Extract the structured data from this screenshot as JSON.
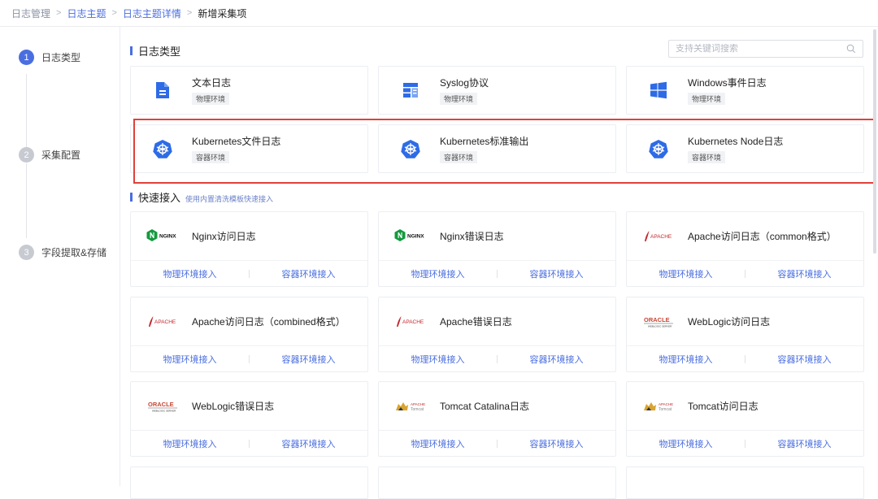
{
  "breadcrumb": {
    "items": [
      "日志管理",
      "日志主题",
      "日志主题详情",
      "新增采集项"
    ],
    "separator": ">"
  },
  "steps": [
    {
      "num": "1",
      "label": "日志类型",
      "active": true
    },
    {
      "num": "2",
      "label": "采集配置",
      "active": false
    },
    {
      "num": "3",
      "label": "字段提取&存储",
      "active": false
    }
  ],
  "log_types": {
    "title": "日志类型",
    "search_placeholder": "支持关键词搜索",
    "cards": [
      {
        "title": "文本日志",
        "tag": "物理环境",
        "icon": "document-icon"
      },
      {
        "title": "Syslog协议",
        "tag": "物理环境",
        "icon": "syslog-icon"
      },
      {
        "title": "Windows事件日志",
        "tag": "物理环境",
        "icon": "windows-icon"
      },
      {
        "title": "Kubernetes文件日志",
        "tag": "容器环境",
        "icon": "kubernetes-icon"
      },
      {
        "title": "Kubernetes标准输出",
        "tag": "容器环境",
        "icon": "kubernetes-icon"
      },
      {
        "title": "Kubernetes Node日志",
        "tag": "容器环境",
        "icon": "kubernetes-icon"
      }
    ]
  },
  "quick_access": {
    "title": "快速接入",
    "subtitle": "使用内置清洗模板快速接入",
    "link_physical": "物理环境接入",
    "link_container": "容器环境接入",
    "cards": [
      {
        "title": "Nginx访问日志",
        "logo": "nginx-logo"
      },
      {
        "title": "Nginx错误日志",
        "logo": "nginx-logo"
      },
      {
        "title": "Apache访问日志（common格式）",
        "logo": "apache-logo"
      },
      {
        "title": "Apache访问日志（combined格式）",
        "logo": "apache-logo"
      },
      {
        "title": "Apache错误日志",
        "logo": "apache-logo"
      },
      {
        "title": "WebLogic访问日志",
        "logo": "oracle-logo"
      },
      {
        "title": "WebLogic错误日志",
        "logo": "oracle-logo"
      },
      {
        "title": "Tomcat Catalina日志",
        "logo": "tomcat-logo"
      },
      {
        "title": "Tomcat访问日志",
        "logo": "tomcat-logo"
      }
    ]
  },
  "logo_text": {
    "nginx": "NGINX",
    "apache": "APACHE",
    "oracle": "ORACLE",
    "oracle_sub": "WEBLOGIC SERVER",
    "tomcat_1": "APACHE",
    "tomcat_2": "Tomcat"
  },
  "colors": {
    "accent": "#4a6ee0",
    "highlight": "#e0413a",
    "nginx": "#139a3e",
    "apache": "#c1272d",
    "oracle": "#c74634"
  }
}
